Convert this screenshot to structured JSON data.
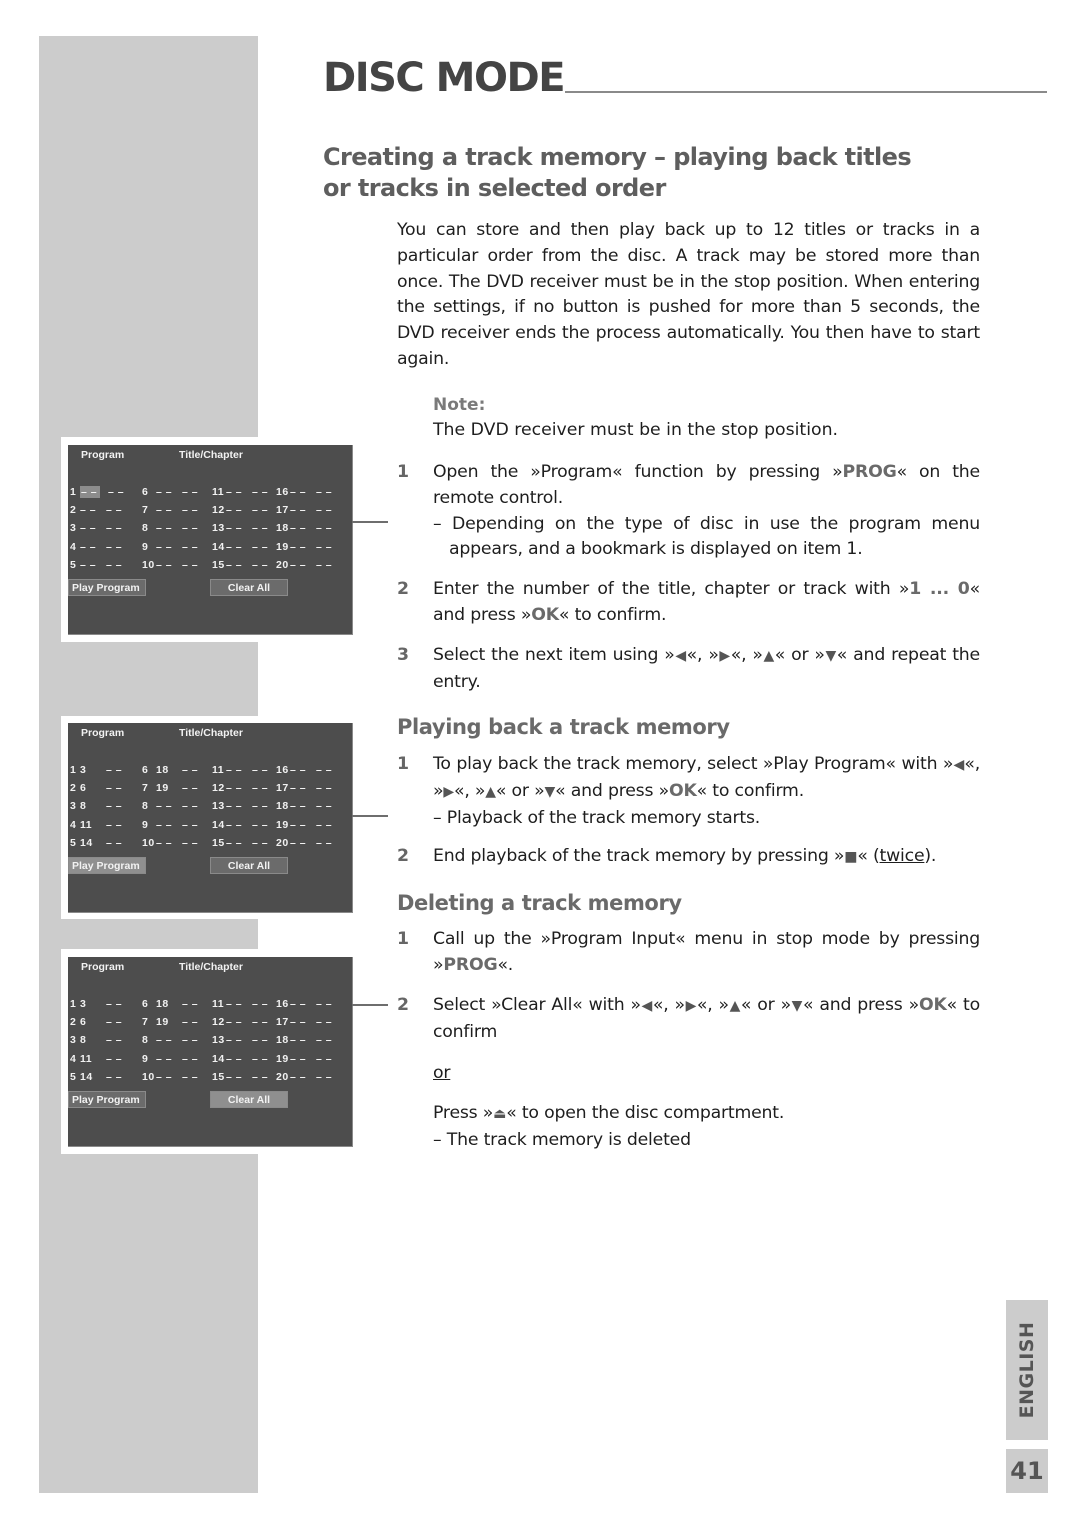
{
  "header": {
    "title": "DISC MODE"
  },
  "section_main": {
    "heading_line1": "Creating a track memory – playing back titles",
    "heading_line2": "or tracks in selected order",
    "intro": "You can store and then play back up to 12 titles or tracks in a particular order from the disc. A track may be stored more than once. The DVD receiver must be in the stop position. When entering the settings, if no button is pushed for more than 5 seconds, the DVD receiver ends the process automatically. You then have to start again.",
    "note_label": "Note:",
    "note_text": "The DVD receiver must be in the stop position.",
    "steps": [
      {
        "num": "1",
        "parts": [
          "Open the »Program« function by pressing »",
          "PROG",
          "« on the remote control."
        ],
        "sub": "– Depending on the type of disc in use the program menu appears, and a bookmark is displayed on item 1."
      },
      {
        "num": "2",
        "parts": [
          "Enter the number of the title, chapter or track with »",
          "1 ... 0",
          "« and press »",
          "OK",
          "« to confirm."
        ]
      },
      {
        "num": "3",
        "parts": [
          "Select the next item using »",
          "«, »",
          "«, »",
          "« or »",
          "« and repeat the entry."
        ]
      }
    ]
  },
  "section_play": {
    "heading": "Playing back a track memory",
    "steps": [
      {
        "num": "1",
        "parts": [
          "To play back the track memory, select »Play Program« with »",
          "«, »",
          "«, »",
          "« or »",
          "« and press »",
          "OK",
          "« to confirm."
        ],
        "sub": "– Playback of the track memory starts."
      },
      {
        "num": "2",
        "parts": [
          "End playback of the track memory by pressing »",
          "« (",
          "twice",
          ")."
        ]
      }
    ]
  },
  "section_delete": {
    "heading": "Deleting a track memory",
    "steps": [
      {
        "num": "1",
        "parts": [
          "Call up the »Program Input« menu in stop mode by pressing »",
          "PROG",
          "«."
        ]
      },
      {
        "num": "2",
        "parts": [
          "Select »Clear All« with »",
          "«, »",
          "«, »",
          "« or »",
          "« and press »",
          "OK",
          "« to confirm"
        ],
        "or": "or",
        "alt_parts": [
          "Press »",
          "« to open the disc compartment."
        ],
        "sub": "– The track memory is deleted"
      }
    ]
  },
  "icons": {
    "left": "◀",
    "right": "▶",
    "up": "▲",
    "down": "▼",
    "stop": "■",
    "eject": "⏏"
  },
  "osd_panels": [
    {
      "header_program": "Program",
      "header_title": "Title/Chapter",
      "columns": [
        [
          [
            "1",
            "– –",
            "– –"
          ],
          [
            "2",
            "– –",
            "– –"
          ],
          [
            "3",
            "– –",
            "– –"
          ],
          [
            "4",
            "– –",
            "– –"
          ],
          [
            "5",
            "– –",
            "– –"
          ]
        ],
        [
          [
            "6",
            "– –",
            "– –"
          ],
          [
            "7",
            "– –",
            "– –"
          ],
          [
            "8",
            "– –",
            "– –"
          ],
          [
            "9",
            "– –",
            "– –"
          ],
          [
            "10",
            "– –",
            "– –"
          ]
        ],
        [
          [
            "11",
            "– –",
            "– –"
          ],
          [
            "12",
            "– –",
            "– –"
          ],
          [
            "13",
            "– –",
            "– –"
          ],
          [
            "14",
            "– –",
            "– –"
          ],
          [
            "15",
            "– –",
            "– –"
          ]
        ],
        [
          [
            "16",
            "– –",
            "– –"
          ],
          [
            "17",
            "– –",
            "– –"
          ],
          [
            "18",
            "– –",
            "– –"
          ],
          [
            "19",
            "– –",
            "– –"
          ],
          [
            "20",
            "– –",
            "– –"
          ]
        ]
      ],
      "bookmark_item": "1",
      "play_label": "Play Program",
      "clear_label": "Clear All",
      "selected": "none"
    },
    {
      "header_program": "Program",
      "header_title": "Title/Chapter",
      "columns": [
        [
          [
            "1",
            "3",
            "– –"
          ],
          [
            "2",
            "6",
            "– –"
          ],
          [
            "3",
            "8",
            "– –"
          ],
          [
            "4",
            "11",
            "– –"
          ],
          [
            "5",
            "14",
            "– –"
          ]
        ],
        [
          [
            "6",
            "18",
            "– –"
          ],
          [
            "7",
            "19",
            "– –"
          ],
          [
            "8",
            "– –",
            "– –"
          ],
          [
            "9",
            "– –",
            "– –"
          ],
          [
            "10",
            "– –",
            "– –"
          ]
        ],
        [
          [
            "11",
            "– –",
            "– –"
          ],
          [
            "12",
            "– –",
            "– –"
          ],
          [
            "13",
            "– –",
            "– –"
          ],
          [
            "14",
            "– –",
            "– –"
          ],
          [
            "15",
            "– –",
            "– –"
          ]
        ],
        [
          [
            "16",
            "– –",
            "– –"
          ],
          [
            "17",
            "– –",
            "– –"
          ],
          [
            "18",
            "– –",
            "– –"
          ],
          [
            "19",
            "– –",
            "– –"
          ],
          [
            "20",
            "– –",
            "– –"
          ]
        ]
      ],
      "bookmark_item": "",
      "play_label": "Play Program",
      "clear_label": "Clear All",
      "selected": "play"
    },
    {
      "header_program": "Program",
      "header_title": "Title/Chapter",
      "columns": [
        [
          [
            "1",
            "3",
            "– –"
          ],
          [
            "2",
            "6",
            "– –"
          ],
          [
            "3",
            "8",
            "– –"
          ],
          [
            "4",
            "11",
            "– –"
          ],
          [
            "5",
            "14",
            "– –"
          ]
        ],
        [
          [
            "6",
            "18",
            "– –"
          ],
          [
            "7",
            "19",
            "– –"
          ],
          [
            "8",
            "– –",
            "– –"
          ],
          [
            "9",
            "– –",
            "– –"
          ],
          [
            "10",
            "– –",
            "– –"
          ]
        ],
        [
          [
            "11",
            "– –",
            "– –"
          ],
          [
            "12",
            "– –",
            "– –"
          ],
          [
            "13",
            "– –",
            "– –"
          ],
          [
            "14",
            "– –",
            "– –"
          ],
          [
            "15",
            "– –",
            "– –"
          ]
        ],
        [
          [
            "16",
            "– –",
            "– –"
          ],
          [
            "17",
            "– –",
            "– –"
          ],
          [
            "18",
            "– –",
            "– –"
          ],
          [
            "19",
            "– –",
            "– –"
          ],
          [
            "20",
            "– –",
            "– –"
          ]
        ]
      ],
      "bookmark_item": "",
      "play_label": "Play Program",
      "clear_label": "Clear All",
      "selected": "clear"
    }
  ],
  "footer": {
    "language": "ENGLISH",
    "page_number": "41"
  }
}
